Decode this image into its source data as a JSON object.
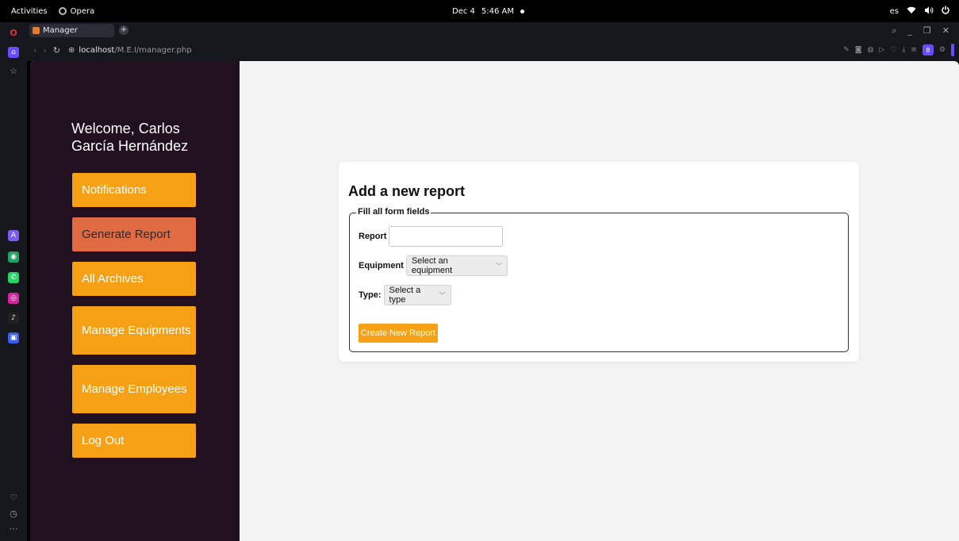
{
  "gnome": {
    "activities": "Activities",
    "app_name": "Opera",
    "date": "Dec 4",
    "time": "5:46 AM",
    "lang": "es"
  },
  "browser": {
    "tab_title": "Manager",
    "url_host": "localhost",
    "url_path": "/M.E.I/manager.php"
  },
  "sidebar": {
    "welcome": "Welcome, Carlos García Hernández",
    "items": [
      {
        "label": "Notifications"
      },
      {
        "label": "Generate Report"
      },
      {
        "label": "All Archives"
      },
      {
        "label": "Manage Equipments"
      },
      {
        "label": "Manage Employees"
      },
      {
        "label": "Log Out"
      }
    ]
  },
  "form": {
    "title": "Add a new report",
    "legend": "Fill all form fields",
    "report_label": "Report",
    "report_value": "",
    "equipment_label": "Equipment",
    "equipment_selected": "Select an equipment",
    "type_label": "Type:",
    "type_selected": "Select a type",
    "submit_label": "Create New Report"
  },
  "colors": {
    "accent": "#f5a015",
    "active_item": "#e06a42",
    "sidebar_bg": "#201020"
  }
}
